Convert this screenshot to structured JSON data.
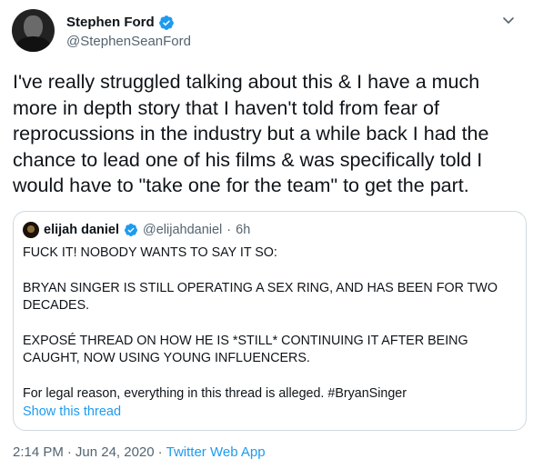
{
  "author": {
    "display_name": "Stephen Ford",
    "handle": "@StephenSeanFord"
  },
  "tweet": {
    "text": "I've really struggled talking about this & I have a much more in depth story that I haven't told from fear of reprocussions in the industry but a while back I had the chance to lead one of his films & was specifically told I would have to \"take one for the team\" to get the part."
  },
  "quote": {
    "display_name": "elijah daniel",
    "handle": "@elijahdaniel",
    "separator": "·",
    "time": "6h",
    "paragraphs": [
      "FUCK IT! NOBODY WANTS TO SAY IT SO:",
      "BRYAN SINGER IS STILL OPERATING A SEX RING, AND HAS BEEN FOR TWO DECADES.",
      "EXPOSÉ THREAD ON HOW HE IS *STILL* CONTINUING IT AFTER BEING CAUGHT, NOW USING YOUNG INFLUENCERS.",
      "For legal reason, everything in this thread is alleged. #BryanSinger"
    ],
    "show_thread": "Show this thread"
  },
  "meta": {
    "time": "2:14 PM",
    "sep1": "·",
    "date": "Jun 24, 2020",
    "sep2": "·",
    "app": "Twitter Web App"
  },
  "icons": {
    "verified": "verified-badge-icon",
    "more": "chevron-down-icon"
  },
  "colors": {
    "accent": "#1d9bf0",
    "secondary_text": "#536471",
    "border": "#cfd9de"
  }
}
